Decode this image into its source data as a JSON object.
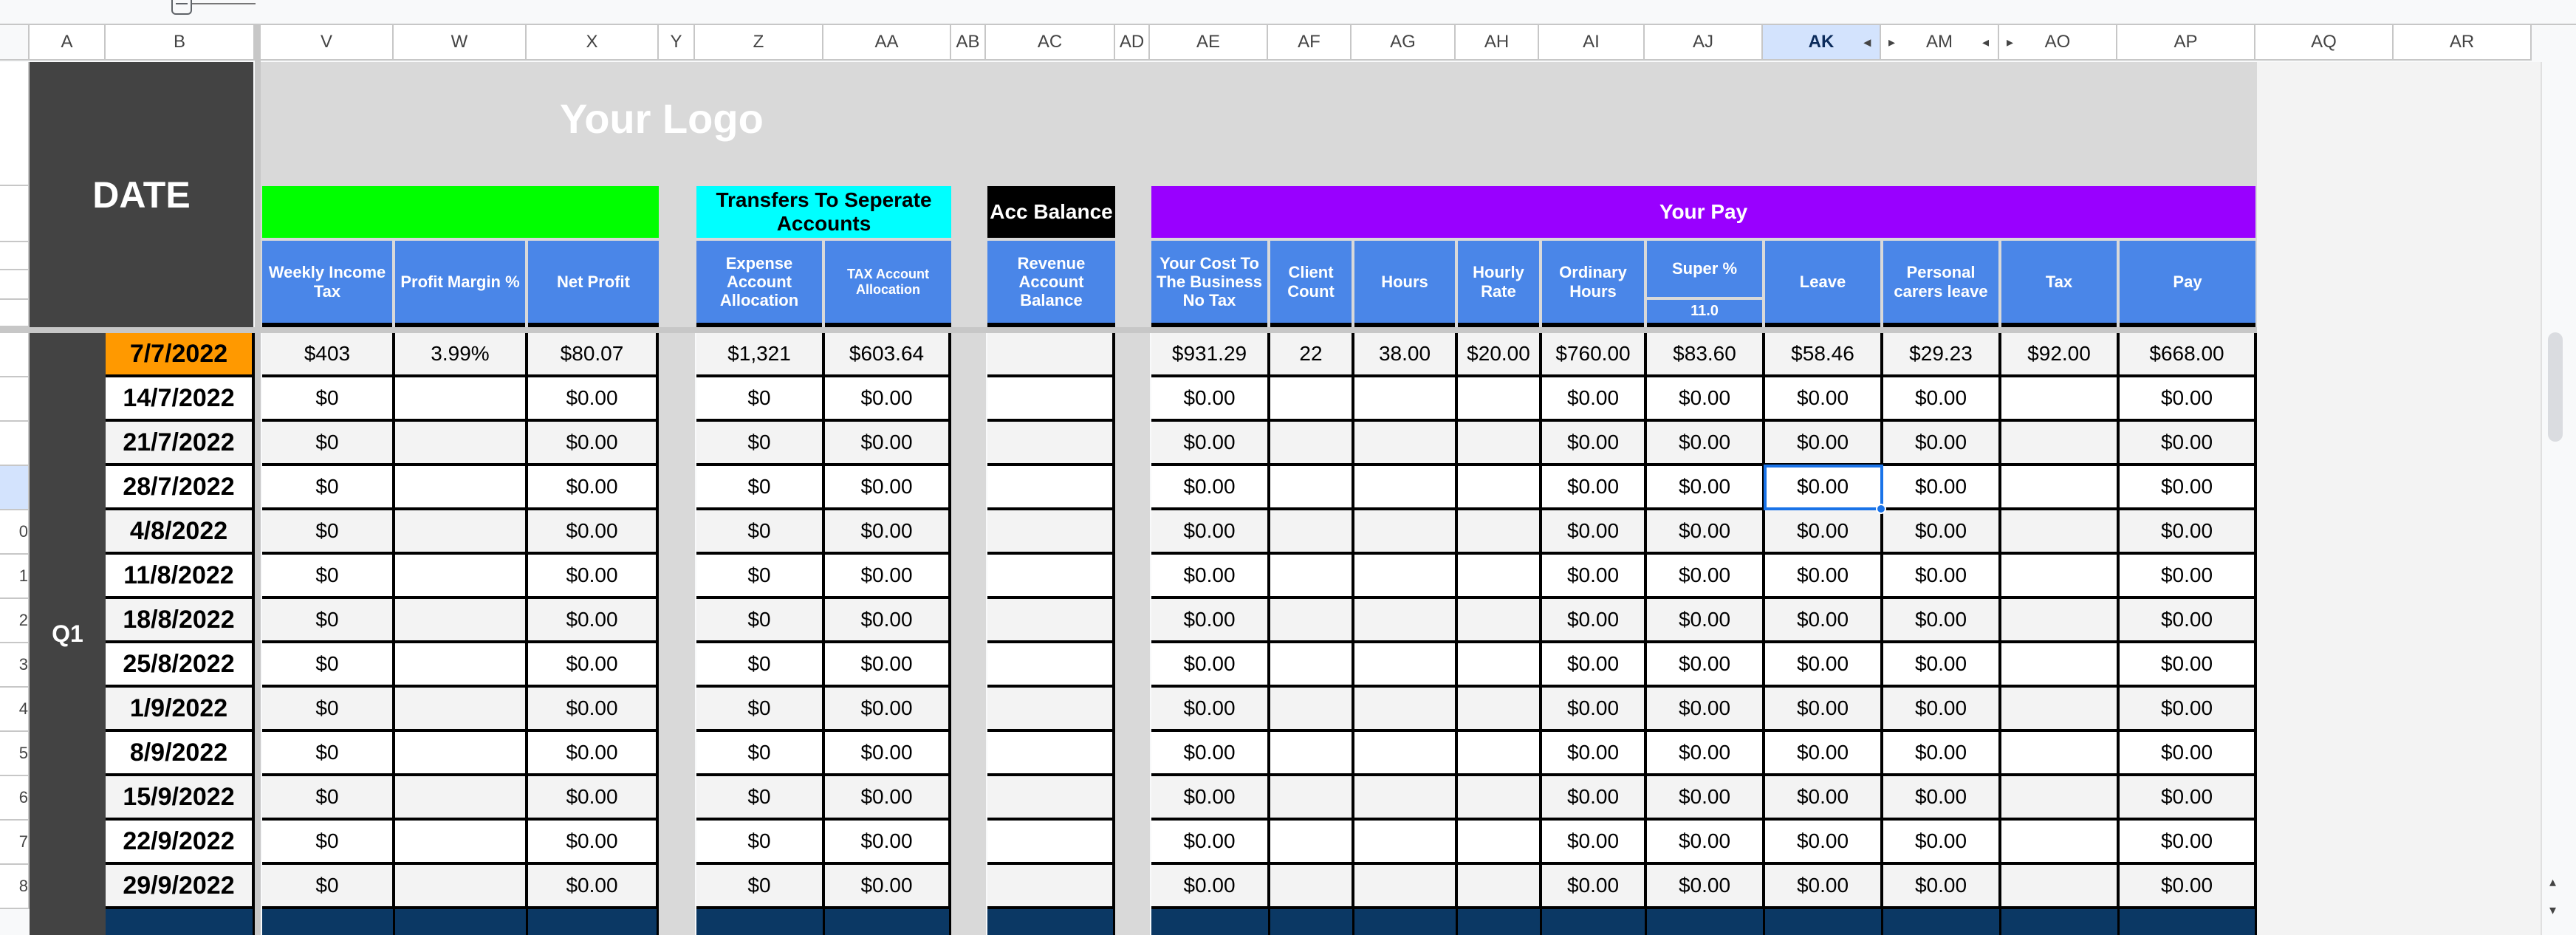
{
  "columns": {
    "row_header": "",
    "letters": [
      "A",
      "B",
      "V",
      "W",
      "X",
      "Y",
      "Z",
      "AA",
      "AB",
      "AC",
      "AD",
      "AE",
      "AF",
      "AG",
      "AH",
      "AI",
      "AJ",
      "AK",
      "AM",
      "AO",
      "AP",
      "AQ",
      "AR"
    ],
    "selected": "AK"
  },
  "header": {
    "date_title": "DATE",
    "logo_text": "Your Logo",
    "transfers_title": "Transfers To Seperate Accounts",
    "acc_balance_title": "Acc Balance",
    "your_pay_title": "Your Pay",
    "colors": {
      "green_band": "#00ff00",
      "cyan_band": "#00ffff",
      "black_band": "#000000",
      "purple_band": "#9900ff",
      "subheader_blue": "#4a86e8",
      "date_orange": "#ff9900",
      "navy_footer": "#0b3864"
    },
    "subheaders": {
      "weekly_income_tax": "Weekly Income Tax",
      "profit_margin": "Profit Margin %",
      "net_profit": "Net Profit",
      "expense_allocation": "Expense Account Allocation",
      "tax_allocation": "TAX Account Allocation",
      "revenue_balance": "Revenue Account Balance",
      "cost_to_business": "Your Cost To The Business No Tax",
      "client_count": "Client Count",
      "hours": "Hours",
      "hourly_rate": "Hourly Rate",
      "ordinary_hours": "Ordinary Hours",
      "super_pct": "Super %",
      "super_value": "11.0",
      "leave": "Leave",
      "personal_carers_leave": "Personal carers leave",
      "tax": "Tax",
      "pay": "Pay"
    }
  },
  "quarter_label": "Q1",
  "row_numbers": [
    "",
    "",
    "",
    "",
    "0",
    "1",
    "2",
    "3",
    "4",
    "5",
    "6",
    "7",
    "8"
  ],
  "rows": [
    {
      "date": "7/7/2022",
      "weekly_income_tax": "$403",
      "profit_margin": "3.99%",
      "net_profit": "$80.07",
      "expense_allocation": "$1,321",
      "tax_allocation": "$603.64",
      "revenue_balance": "",
      "cost_to_business": "$931.29",
      "client_count": "22",
      "hours": "38.00",
      "hourly_rate": "$20.00",
      "ordinary_hours": "$760.00",
      "super": "$83.60",
      "leave": "$58.46",
      "personal_carers_leave": "$29.23",
      "tax": "$92.00",
      "pay": "$668.00"
    },
    {
      "date": "14/7/2022",
      "weekly_income_tax": "$0",
      "profit_margin": "",
      "net_profit": "$0.00",
      "expense_allocation": "$0",
      "tax_allocation": "$0.00",
      "revenue_balance": "",
      "cost_to_business": "$0.00",
      "client_count": "",
      "hours": "",
      "hourly_rate": "",
      "ordinary_hours": "$0.00",
      "super": "$0.00",
      "leave": "$0.00",
      "personal_carers_leave": "$0.00",
      "tax": "",
      "pay": "$0.00"
    },
    {
      "date": "21/7/2022",
      "weekly_income_tax": "$0",
      "profit_margin": "",
      "net_profit": "$0.00",
      "expense_allocation": "$0",
      "tax_allocation": "$0.00",
      "revenue_balance": "",
      "cost_to_business": "$0.00",
      "client_count": "",
      "hours": "",
      "hourly_rate": "",
      "ordinary_hours": "$0.00",
      "super": "$0.00",
      "leave": "$0.00",
      "personal_carers_leave": "$0.00",
      "tax": "",
      "pay": "$0.00"
    },
    {
      "date": "28/7/2022",
      "weekly_income_tax": "$0",
      "profit_margin": "",
      "net_profit": "$0.00",
      "expense_allocation": "$0",
      "tax_allocation": "$0.00",
      "revenue_balance": "",
      "cost_to_business": "$0.00",
      "client_count": "",
      "hours": "",
      "hourly_rate": "",
      "ordinary_hours": "$0.00",
      "super": "$0.00",
      "leave": "$0.00",
      "personal_carers_leave": "$0.00",
      "tax": "",
      "pay": "$0.00"
    },
    {
      "date": "4/8/2022",
      "weekly_income_tax": "$0",
      "profit_margin": "",
      "net_profit": "$0.00",
      "expense_allocation": "$0",
      "tax_allocation": "$0.00",
      "revenue_balance": "",
      "cost_to_business": "$0.00",
      "client_count": "",
      "hours": "",
      "hourly_rate": "",
      "ordinary_hours": "$0.00",
      "super": "$0.00",
      "leave": "$0.00",
      "personal_carers_leave": "$0.00",
      "tax": "",
      "pay": "$0.00"
    },
    {
      "date": "11/8/2022",
      "weekly_income_tax": "$0",
      "profit_margin": "",
      "net_profit": "$0.00",
      "expense_allocation": "$0",
      "tax_allocation": "$0.00",
      "revenue_balance": "",
      "cost_to_business": "$0.00",
      "client_count": "",
      "hours": "",
      "hourly_rate": "",
      "ordinary_hours": "$0.00",
      "super": "$0.00",
      "leave": "$0.00",
      "personal_carers_leave": "$0.00",
      "tax": "",
      "pay": "$0.00"
    },
    {
      "date": "18/8/2022",
      "weekly_income_tax": "$0",
      "profit_margin": "",
      "net_profit": "$0.00",
      "expense_allocation": "$0",
      "tax_allocation": "$0.00",
      "revenue_balance": "",
      "cost_to_business": "$0.00",
      "client_count": "",
      "hours": "",
      "hourly_rate": "",
      "ordinary_hours": "$0.00",
      "super": "$0.00",
      "leave": "$0.00",
      "personal_carers_leave": "$0.00",
      "tax": "",
      "pay": "$0.00"
    },
    {
      "date": "25/8/2022",
      "weekly_income_tax": "$0",
      "profit_margin": "",
      "net_profit": "$0.00",
      "expense_allocation": "$0",
      "tax_allocation": "$0.00",
      "revenue_balance": "",
      "cost_to_business": "$0.00",
      "client_count": "",
      "hours": "",
      "hourly_rate": "",
      "ordinary_hours": "$0.00",
      "super": "$0.00",
      "leave": "$0.00",
      "personal_carers_leave": "$0.00",
      "tax": "",
      "pay": "$0.00"
    },
    {
      "date": "1/9/2022",
      "weekly_income_tax": "$0",
      "profit_margin": "",
      "net_profit": "$0.00",
      "expense_allocation": "$0",
      "tax_allocation": "$0.00",
      "revenue_balance": "",
      "cost_to_business": "$0.00",
      "client_count": "",
      "hours": "",
      "hourly_rate": "",
      "ordinary_hours": "$0.00",
      "super": "$0.00",
      "leave": "$0.00",
      "personal_carers_leave": "$0.00",
      "tax": "",
      "pay": "$0.00"
    },
    {
      "date": "8/9/2022",
      "weekly_income_tax": "$0",
      "profit_margin": "",
      "net_profit": "$0.00",
      "expense_allocation": "$0",
      "tax_allocation": "$0.00",
      "revenue_balance": "",
      "cost_to_business": "$0.00",
      "client_count": "",
      "hours": "",
      "hourly_rate": "",
      "ordinary_hours": "$0.00",
      "super": "$0.00",
      "leave": "$0.00",
      "personal_carers_leave": "$0.00",
      "tax": "",
      "pay": "$0.00"
    },
    {
      "date": "15/9/2022",
      "weekly_income_tax": "$0",
      "profit_margin": "",
      "net_profit": "$0.00",
      "expense_allocation": "$0",
      "tax_allocation": "$0.00",
      "revenue_balance": "",
      "cost_to_business": "$0.00",
      "client_count": "",
      "hours": "",
      "hourly_rate": "",
      "ordinary_hours": "$0.00",
      "super": "$0.00",
      "leave": "$0.00",
      "personal_carers_leave": "$0.00",
      "tax": "",
      "pay": "$0.00"
    },
    {
      "date": "22/9/2022",
      "weekly_income_tax": "$0",
      "profit_margin": "",
      "net_profit": "$0.00",
      "expense_allocation": "$0",
      "tax_allocation": "$0.00",
      "revenue_balance": "",
      "cost_to_business": "$0.00",
      "client_count": "",
      "hours": "",
      "hourly_rate": "",
      "ordinary_hours": "$0.00",
      "super": "$0.00",
      "leave": "$0.00",
      "personal_carers_leave": "$0.00",
      "tax": "",
      "pay": "$0.00"
    },
    {
      "date": "29/9/2022",
      "weekly_income_tax": "$0",
      "profit_margin": "",
      "net_profit": "$0.00",
      "expense_allocation": "$0",
      "tax_allocation": "$0.00",
      "revenue_balance": "",
      "cost_to_business": "$0.00",
      "client_count": "",
      "hours": "",
      "hourly_rate": "",
      "ordinary_hours": "$0.00",
      "super": "$0.00",
      "leave": "$0.00",
      "personal_carers_leave": "$0.00",
      "tax": "",
      "pay": "$0.00"
    }
  ],
  "selection": {
    "cell": "AK",
    "row_index": 3
  }
}
